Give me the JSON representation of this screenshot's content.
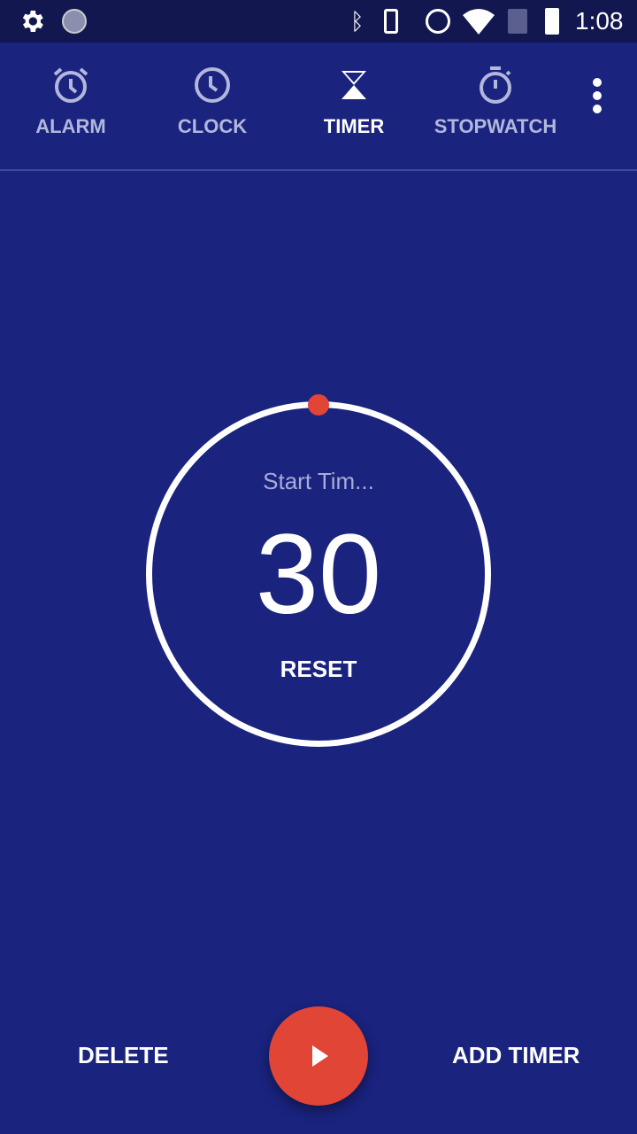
{
  "status_bar": {
    "time": "1:08",
    "icons": [
      "settings-icon",
      "sync-icon",
      "bluetooth-icon",
      "vibrate-icon",
      "alarm-icon",
      "wifi-icon",
      "no-sim-icon",
      "battery-charging-icon"
    ]
  },
  "tabs": [
    {
      "label": "ALARM",
      "icon": "alarm-icon"
    },
    {
      "label": "CLOCK",
      "icon": "clock-icon"
    },
    {
      "label": "TIMER",
      "icon": "hourglass-icon",
      "active": true
    },
    {
      "label": "STOPWATCH",
      "icon": "stopwatch-icon"
    }
  ],
  "timer": {
    "label": "Start Tim...",
    "value": "30",
    "reset_label": "RESET",
    "progress": 0
  },
  "actions": {
    "delete": "DELETE",
    "add": "ADD TIMER"
  },
  "colors": {
    "background": "#1a237e",
    "accent": "#e04535"
  }
}
